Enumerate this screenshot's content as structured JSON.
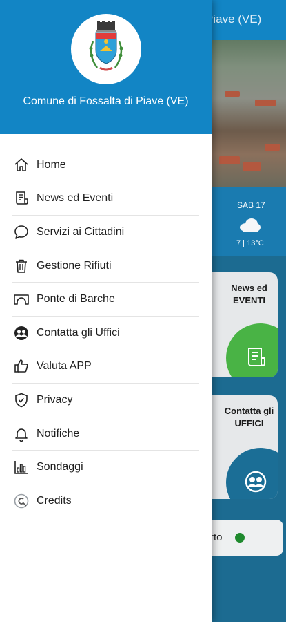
{
  "app": {
    "background_title": "Piave (VE)",
    "municipality_name": "Comune di Fossalta di Piave (VE)"
  },
  "weather": {
    "day": "SAB 17",
    "temps": "7 | 13°C",
    "icon": "cloud-icon"
  },
  "cards": {
    "news": {
      "label": "News ed\nEVENTI",
      "icon": "news-icon",
      "color": "#49b345"
    },
    "uffici": {
      "label": "Contatta gli\nUFFICI",
      "icon": "contacts-icon",
      "color": "#1b6e96"
    }
  },
  "status_pill": {
    "text": "rto",
    "status_color": "#1f8a2e"
  },
  "menu": {
    "items": [
      {
        "label": "Home",
        "icon": "home-icon"
      },
      {
        "label": "News ed Eventi",
        "icon": "newspaper-icon"
      },
      {
        "label": "Servizi ai Cittadini",
        "icon": "chat-bubble-icon"
      },
      {
        "label": "Gestione Rifiuti",
        "icon": "trash-icon"
      },
      {
        "label": "Ponte di Barche",
        "icon": "bridge-icon"
      },
      {
        "label": "Contatta gli Uffici",
        "icon": "people-icon"
      },
      {
        "label": "Valuta APP",
        "icon": "thumbs-up-icon"
      },
      {
        "label": "Privacy",
        "icon": "shield-icon"
      },
      {
        "label": "Notifiche",
        "icon": "bell-icon"
      },
      {
        "label": "Sondaggi",
        "icon": "bar-chart-icon"
      },
      {
        "label": "Credits",
        "icon": "credits-icon"
      }
    ]
  },
  "colors": {
    "primary": "#1285c5",
    "accent_green": "#49b345",
    "accent_blue": "#1b6e96"
  }
}
